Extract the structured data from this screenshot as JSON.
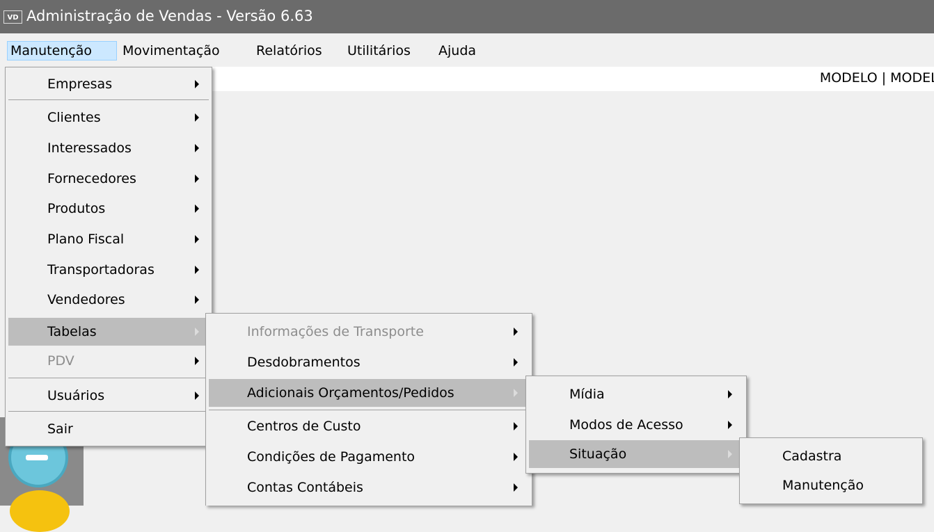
{
  "window": {
    "icon_text": "VD",
    "title": "Administração de Vendas - Versão 6.63"
  },
  "menubar": {
    "items": [
      "Manutenção",
      "Movimentação",
      "Relatórios",
      "Utilitários",
      "Ajuda"
    ]
  },
  "header": {
    "company_label": "MODELO | MODELO"
  },
  "menu_manutencao": {
    "items": [
      "Empresas",
      "Clientes",
      "Interessados",
      "Fornecedores",
      "Produtos",
      "Plano Fiscal",
      "Transportadoras",
      "Vendedores",
      "Tabelas",
      "PDV",
      "Usuários",
      "Sair"
    ]
  },
  "menu_tabelas": {
    "items": [
      "Informações de Transporte",
      "Desdobramentos",
      "Adicionais Orçamentos/Pedidos",
      "Centros de Custo",
      "Condições de Pagamento",
      "Contas Contábeis"
    ]
  },
  "menu_adicionais": {
    "items": [
      "Mídia",
      "Modos de Acesso",
      "Situação"
    ]
  },
  "menu_situacao": {
    "items": [
      "Cadastra",
      "Manutenção"
    ]
  },
  "colors": {
    "titlebar": "#6b6b6b",
    "menu_background": "#f0f0f0",
    "highlight": "#bdbdbd",
    "disabled_text": "#8d8d8d"
  }
}
